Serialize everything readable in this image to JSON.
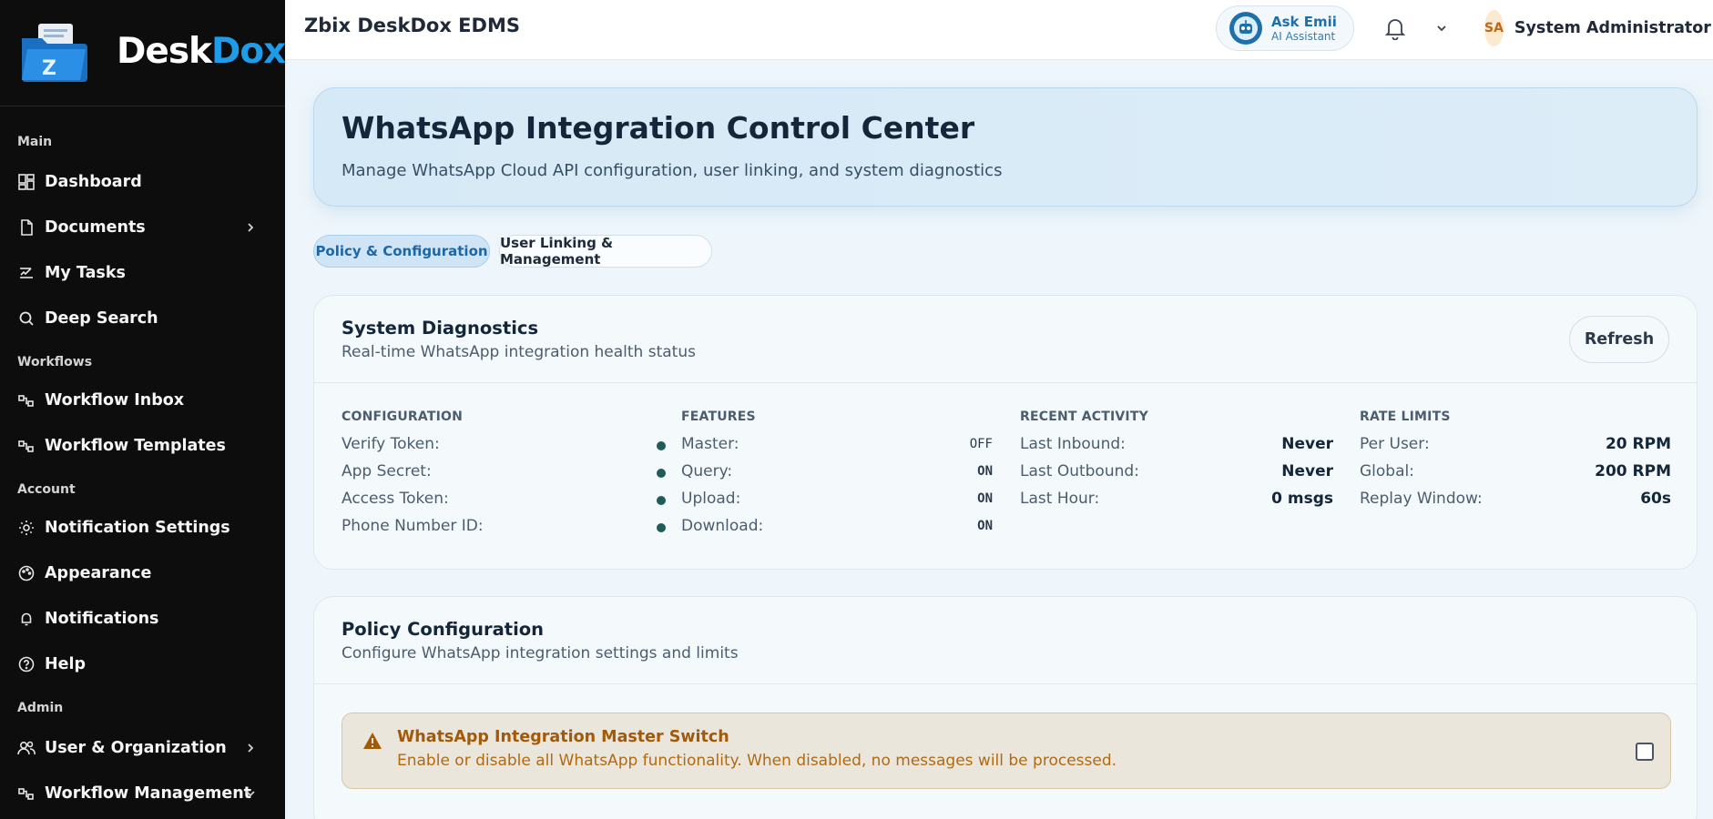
{
  "sidebar": {
    "brand": {
      "part1": "Desk",
      "part2": "Dox"
    },
    "sections": {
      "main": "Main",
      "workflows": "Workflows",
      "account": "Account",
      "admin": "Admin"
    },
    "items": {
      "dashboard": "Dashboard",
      "documents": "Documents",
      "my_tasks": "My Tasks",
      "deep_search": "Deep Search",
      "workflow_inbox": "Workflow Inbox",
      "workflow_templates": "Workflow Templates",
      "notification_settings": "Notification Settings",
      "appearance": "Appearance",
      "notifications": "Notifications",
      "help": "Help",
      "user_org": "User & Organization",
      "workflow_management": "Workflow Management"
    }
  },
  "topbar": {
    "app_title": "Zbix DeskDox EDMS",
    "assistant": {
      "name": "Ask Emii",
      "subtitle": "AI Assistant"
    },
    "user": {
      "initials": "SA",
      "name": "System Administrator"
    }
  },
  "hero": {
    "title": "WhatsApp Integration Control Center",
    "subtitle": "Manage WhatsApp Cloud API configuration, user linking, and system diagnostics"
  },
  "tabs": {
    "policy": "Policy & Configuration",
    "linking": "User Linking & Management"
  },
  "diagnostics": {
    "title": "System Diagnostics",
    "subtitle": "Real-time WhatsApp integration health status",
    "refresh_label": "Refresh",
    "configuration": {
      "heading": "CONFIGURATION",
      "rows": [
        {
          "label": "Verify Token:"
        },
        {
          "label": "App Secret:"
        },
        {
          "label": "Access Token:"
        },
        {
          "label": "Phone Number ID:"
        }
      ]
    },
    "features": {
      "heading": "FEATURES",
      "rows": [
        {
          "label": "Master:",
          "value": "OFF"
        },
        {
          "label": "Query:",
          "value": "ON"
        },
        {
          "label": "Upload:",
          "value": "ON"
        },
        {
          "label": "Download:",
          "value": "ON"
        }
      ]
    },
    "recent_activity": {
      "heading": "RECENT ACTIVITY",
      "rows": [
        {
          "label": "Last Inbound:",
          "value": "Never"
        },
        {
          "label": "Last Outbound:",
          "value": "Never"
        },
        {
          "label": "Last Hour:",
          "value": "0 msgs"
        }
      ]
    },
    "rate_limits": {
      "heading": "RATE LIMITS",
      "rows": [
        {
          "label": "Per User:",
          "value": "20 RPM"
        },
        {
          "label": "Global:",
          "value": "200 RPM"
        },
        {
          "label": "Replay Window:",
          "value": "60s"
        }
      ]
    }
  },
  "policy": {
    "title": "Policy Configuration",
    "subtitle": "Configure WhatsApp integration settings and limits",
    "master_switch": {
      "title": "WhatsApp Integration Master Switch",
      "description": "Enable or disable all WhatsApp functionality. When disabled, no messages will be processed."
    }
  },
  "icons": {
    "status_dot_color": "#1f5b58",
    "brand_accent": "#1e9be9",
    "warning_color": "#a05a0a"
  }
}
